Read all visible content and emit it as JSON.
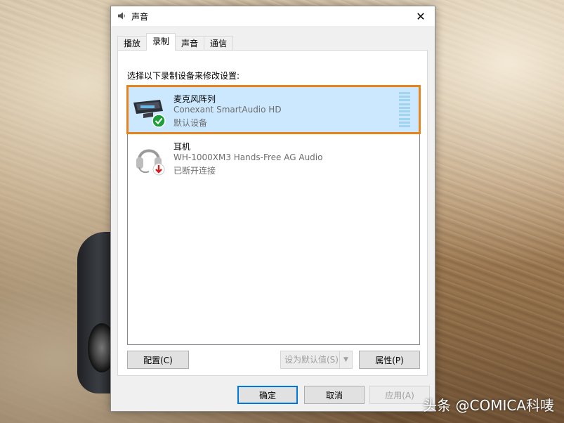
{
  "window": {
    "title": "声音",
    "close_glyph": "✕"
  },
  "tabs": [
    {
      "label": "播放",
      "active": false
    },
    {
      "label": "录制",
      "active": true
    },
    {
      "label": "声音",
      "active": false
    },
    {
      "label": "通信",
      "active": false
    }
  ],
  "instructions": "选择以下录制设备来修改设置:",
  "devices": [
    {
      "name": "麦克风阵列",
      "subtitle": "Conexant SmartAudio HD",
      "status": "默认设备",
      "icon": "microphone-array-icon",
      "badge": "green-check-icon",
      "selected": true
    },
    {
      "name": "耳机",
      "subtitle": "WH-1000XM3 Hands-Free AG Audio",
      "status": "已断开连接",
      "icon": "headset-icon",
      "badge": "red-down-arrow-icon",
      "selected": false
    }
  ],
  "buttons": {
    "configure": "配置(C)",
    "set_default": "设为默认值(S)",
    "properties": "属性(P)",
    "ok": "确定",
    "cancel": "取消",
    "apply": "应用(A)"
  },
  "colors": {
    "selection": "#cce8ff",
    "focus_highlight": "#e8821a",
    "primary_border": "#0078d7"
  },
  "watermark": "头条 @COMICA科唛"
}
